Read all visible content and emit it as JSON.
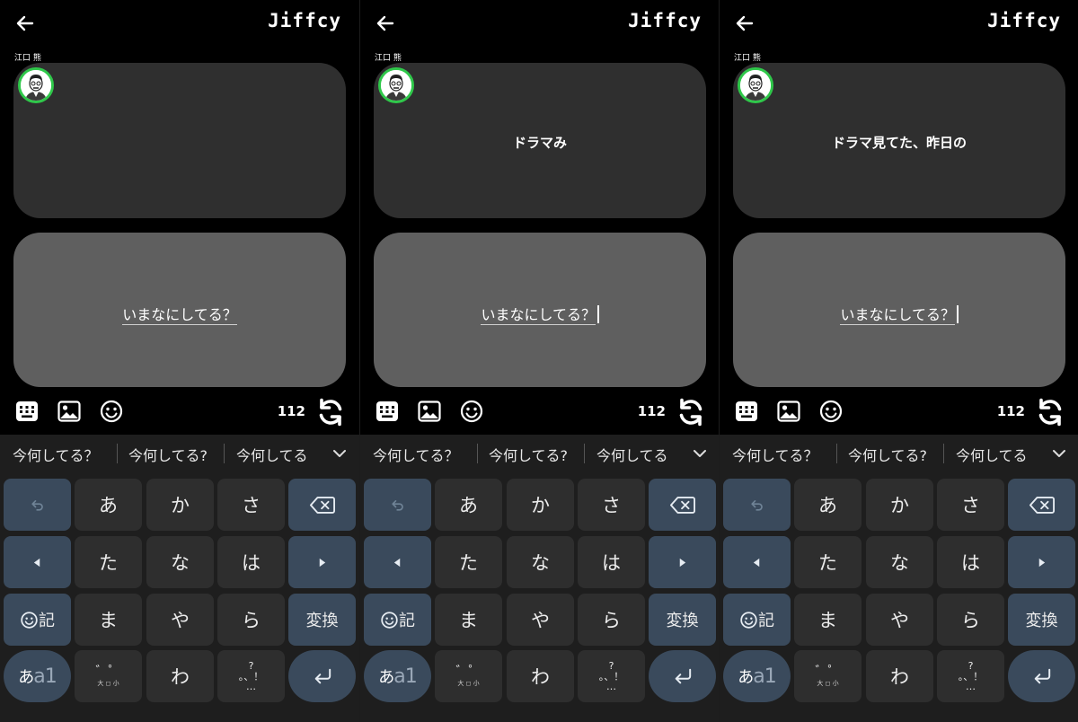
{
  "colors": {
    "background": "#000000",
    "card_top": "#2f2f2f",
    "card_bottom": "#5f5f5f",
    "avatar_ring": "#2fc84a",
    "keyboard_bg": "#1e1e1e",
    "key_bg": "#2e2e2e",
    "function_key_bg": "#3a4a5c"
  },
  "screens": [
    {
      "header": {
        "back_icon": "arrow-left-icon",
        "brand": "Jiffcy"
      },
      "username": "江口 熊",
      "post": {
        "avatar_icon": "avatar-icon",
        "text": ""
      },
      "compose": {
        "prompt": "いまなにしてる？",
        "caret_visible": false
      },
      "toolbar": {
        "icons": [
          "keyboard-icon",
          "image-icon",
          "smiley-icon"
        ],
        "counter": "112",
        "refresh_icon": "refresh-icon"
      },
      "suggestions": [
        "今何してる？",
        "今何してる?",
        "今何してる"
      ],
      "keyboard": {
        "undo_icon": "undo-icon",
        "backspace_icon": "backspace-icon",
        "left_icon": "cursor-left-icon",
        "right_icon": "cursor-right-icon",
        "kana_rows": [
          [
            "あ",
            "か",
            "さ"
          ],
          [
            "た",
            "な",
            "は"
          ],
          [
            "ま",
            "や",
            "ら"
          ]
        ],
        "emoji_key_symbol": "記",
        "convert": "変換",
        "mode_kana": "あ",
        "mode_alpha": "a1",
        "dakuten_top": "゛゜",
        "dakuten_bottom": "大 ◻ 小",
        "wa": "わ",
        "punct_top": "?",
        "punct_mid": "。、！",
        "punct_bottom": "…",
        "enter_icon": "enter-icon"
      }
    },
    {
      "header": {
        "back_icon": "arrow-left-icon",
        "brand": "Jiffcy"
      },
      "username": "江口 熊",
      "post": {
        "avatar_icon": "avatar-icon",
        "text": "ドラマみ"
      },
      "compose": {
        "prompt": "いまなにしてる？",
        "caret_visible": true
      },
      "toolbar": {
        "icons": [
          "keyboard-icon",
          "image-icon",
          "smiley-icon"
        ],
        "counter": "112",
        "refresh_icon": "refresh-icon"
      },
      "suggestions": [
        "今何してる？",
        "今何してる?",
        "今何してる"
      ],
      "keyboard": {
        "undo_icon": "undo-icon",
        "backspace_icon": "backspace-icon",
        "left_icon": "cursor-left-icon",
        "right_icon": "cursor-right-icon",
        "kana_rows": [
          [
            "あ",
            "か",
            "さ"
          ],
          [
            "た",
            "な",
            "は"
          ],
          [
            "ま",
            "や",
            "ら"
          ]
        ],
        "emoji_key_symbol": "記",
        "convert": "変換",
        "mode_kana": "あ",
        "mode_alpha": "a1",
        "dakuten_top": "゛゜",
        "dakuten_bottom": "大 ◻ 小",
        "wa": "わ",
        "punct_top": "?",
        "punct_mid": "。、！",
        "punct_bottom": "…",
        "enter_icon": "enter-icon"
      }
    },
    {
      "header": {
        "back_icon": "arrow-left-icon",
        "brand": "Jiffcy"
      },
      "username": "江口 熊",
      "post": {
        "avatar_icon": "avatar-icon",
        "text": "ドラマ見てた、昨日の"
      },
      "compose": {
        "prompt": "いまなにしてる？",
        "caret_visible": true
      },
      "toolbar": {
        "icons": [
          "keyboard-icon",
          "image-icon",
          "smiley-icon"
        ],
        "counter": "112",
        "refresh_icon": "refresh-icon"
      },
      "suggestions": [
        "今何してる？",
        "今何してる?",
        "今何してる"
      ],
      "keyboard": {
        "undo_icon": "undo-icon",
        "backspace_icon": "backspace-icon",
        "left_icon": "cursor-left-icon",
        "right_icon": "cursor-right-icon",
        "kana_rows": [
          [
            "あ",
            "か",
            "さ"
          ],
          [
            "た",
            "な",
            "は"
          ],
          [
            "ま",
            "や",
            "ら"
          ]
        ],
        "emoji_key_symbol": "記",
        "convert": "変換",
        "mode_kana": "あ",
        "mode_alpha": "a1",
        "dakuten_top": "゛゜",
        "dakuten_bottom": "大 ◻ 小",
        "wa": "わ",
        "punct_top": "?",
        "punct_mid": "。、！",
        "punct_bottom": "…",
        "enter_icon": "enter-icon"
      }
    }
  ]
}
